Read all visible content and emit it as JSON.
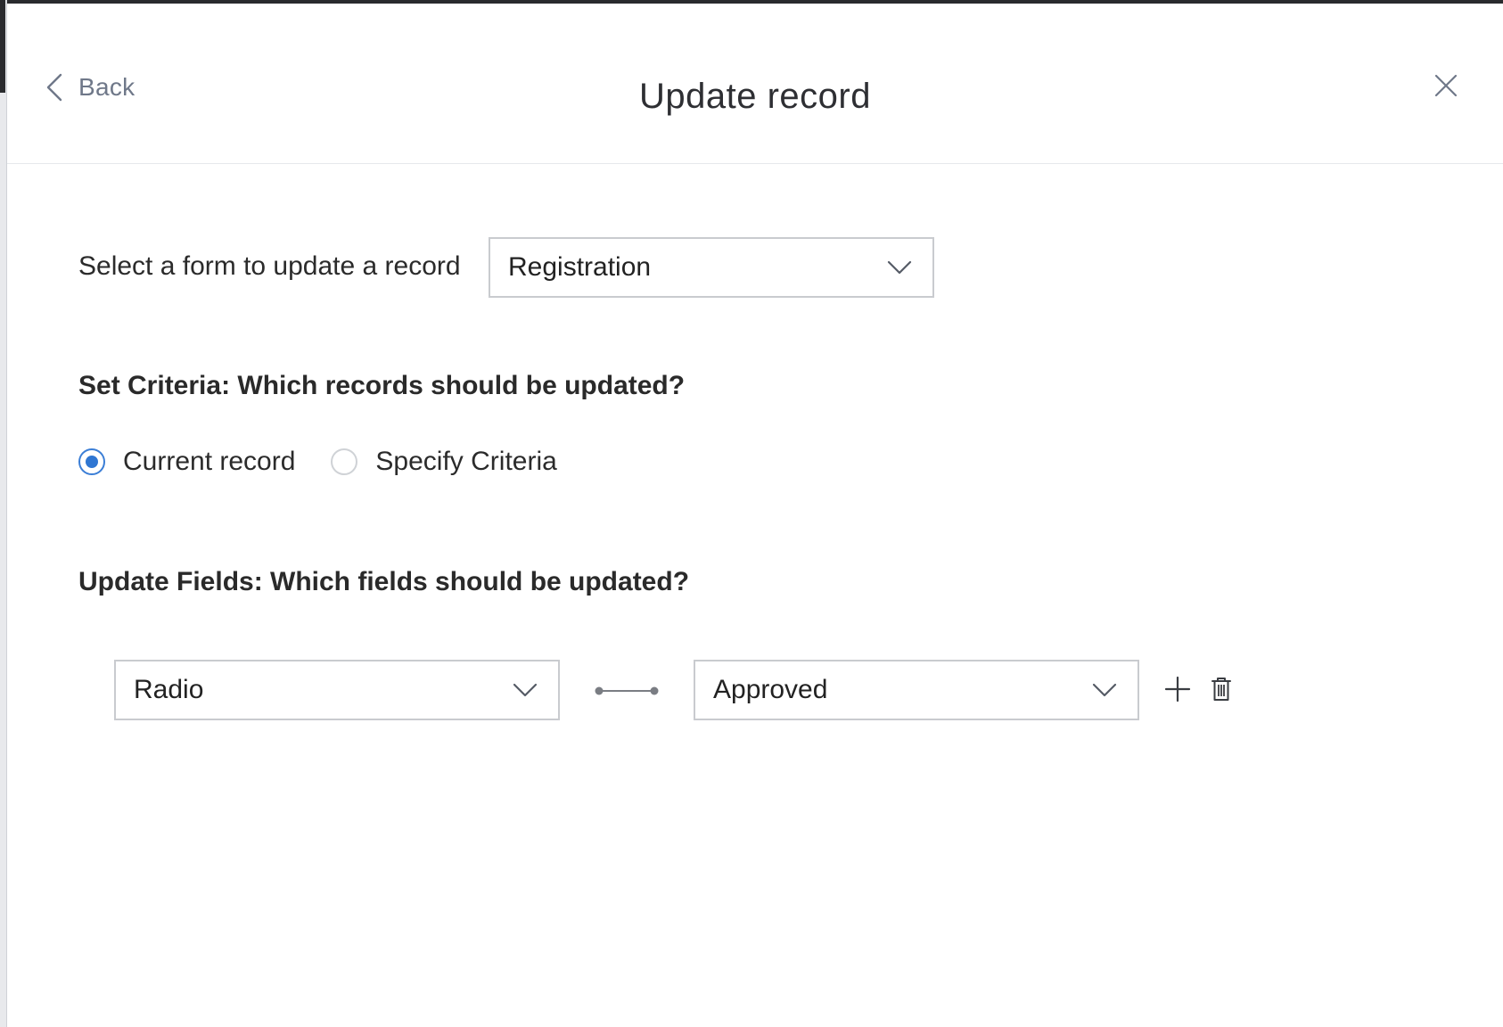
{
  "header": {
    "back_label": "Back",
    "title": "Update record"
  },
  "form_select": {
    "label": "Select a form to update a record",
    "value": "Registration"
  },
  "criteria": {
    "title": "Set Criteria: Which records should be updated?",
    "options": [
      {
        "label": "Current record",
        "checked": true
      },
      {
        "label": "Specify Criteria",
        "checked": false
      }
    ]
  },
  "update_fields": {
    "title": "Update Fields: Which fields should be updated?",
    "rows": [
      {
        "field": "Radio",
        "value": "Approved"
      }
    ]
  },
  "icons": {
    "back": "chevron-left-icon",
    "close": "close-icon",
    "dropdown": "chevron-down-icon",
    "add": "plus-icon",
    "delete": "trash-icon"
  },
  "colors": {
    "accent": "#2f76d2",
    "border": "#c9cbcf",
    "muted_text": "#6f7889"
  }
}
